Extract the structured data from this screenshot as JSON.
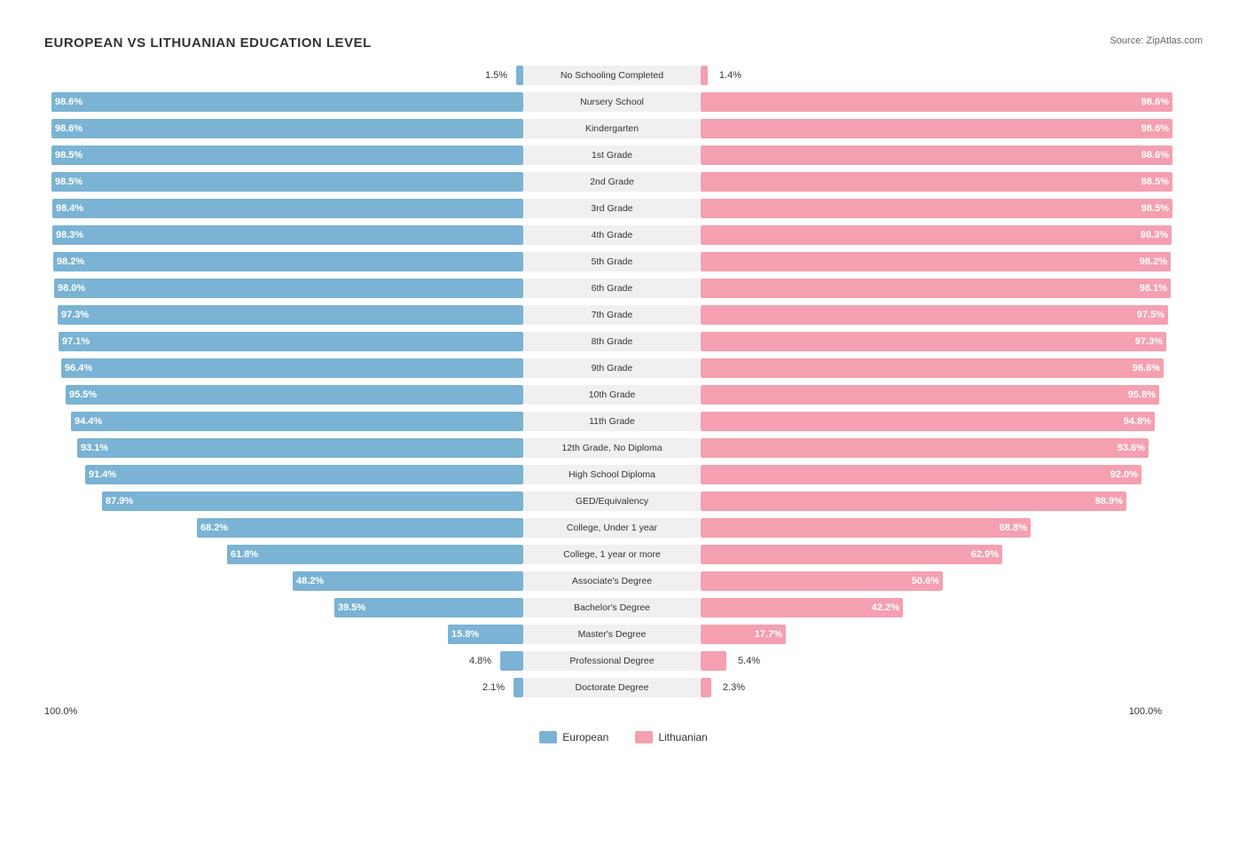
{
  "title": "EUROPEAN VS LITHUANIAN EDUCATION LEVEL",
  "source": "Source: ZipAtlas.com",
  "colors": {
    "blue": "#7ab3d4",
    "pink": "#f4a0b0",
    "label_bg": "#e8e8e8"
  },
  "legend": {
    "european": "European",
    "lithuanian": "Lithuanian"
  },
  "axis": {
    "left": "100.0%",
    "right": "100.0%"
  },
  "rows": [
    {
      "label": "No Schooling Completed",
      "left_val": "1.5%",
      "right_val": "1.4%",
      "left_pct": 1.5,
      "right_pct": 1.4
    },
    {
      "label": "Nursery School",
      "left_val": "98.6%",
      "right_val": "98.6%",
      "left_pct": 98.6,
      "right_pct": 98.6
    },
    {
      "label": "Kindergarten",
      "left_val": "98.6%",
      "right_val": "98.6%",
      "left_pct": 98.6,
      "right_pct": 98.6
    },
    {
      "label": "1st Grade",
      "left_val": "98.5%",
      "right_val": "98.6%",
      "left_pct": 98.5,
      "right_pct": 98.6
    },
    {
      "label": "2nd Grade",
      "left_val": "98.5%",
      "right_val": "98.5%",
      "left_pct": 98.5,
      "right_pct": 98.5
    },
    {
      "label": "3rd Grade",
      "left_val": "98.4%",
      "right_val": "98.5%",
      "left_pct": 98.4,
      "right_pct": 98.5
    },
    {
      "label": "4th Grade",
      "left_val": "98.3%",
      "right_val": "98.3%",
      "left_pct": 98.3,
      "right_pct": 98.3
    },
    {
      "label": "5th Grade",
      "left_val": "98.2%",
      "right_val": "98.2%",
      "left_pct": 98.2,
      "right_pct": 98.2
    },
    {
      "label": "6th Grade",
      "left_val": "98.0%",
      "right_val": "98.1%",
      "left_pct": 98.0,
      "right_pct": 98.1
    },
    {
      "label": "7th Grade",
      "left_val": "97.3%",
      "right_val": "97.5%",
      "left_pct": 97.3,
      "right_pct": 97.5
    },
    {
      "label": "8th Grade",
      "left_val": "97.1%",
      "right_val": "97.3%",
      "left_pct": 97.1,
      "right_pct": 97.3
    },
    {
      "label": "9th Grade",
      "left_val": "96.4%",
      "right_val": "96.6%",
      "left_pct": 96.4,
      "right_pct": 96.6
    },
    {
      "label": "10th Grade",
      "left_val": "95.5%",
      "right_val": "95.8%",
      "left_pct": 95.5,
      "right_pct": 95.8
    },
    {
      "label": "11th Grade",
      "left_val": "94.4%",
      "right_val": "94.8%",
      "left_pct": 94.4,
      "right_pct": 94.8
    },
    {
      "label": "12th Grade, No Diploma",
      "left_val": "93.1%",
      "right_val": "93.6%",
      "left_pct": 93.1,
      "right_pct": 93.6
    },
    {
      "label": "High School Diploma",
      "left_val": "91.4%",
      "right_val": "92.0%",
      "left_pct": 91.4,
      "right_pct": 92.0
    },
    {
      "label": "GED/Equivalency",
      "left_val": "87.9%",
      "right_val": "88.9%",
      "left_pct": 87.9,
      "right_pct": 88.9
    },
    {
      "label": "College, Under 1 year",
      "left_val": "68.2%",
      "right_val": "68.8%",
      "left_pct": 68.2,
      "right_pct": 68.8
    },
    {
      "label": "College, 1 year or more",
      "left_val": "61.8%",
      "right_val": "62.9%",
      "left_pct": 61.8,
      "right_pct": 62.9
    },
    {
      "label": "Associate's Degree",
      "left_val": "48.2%",
      "right_val": "50.6%",
      "left_pct": 48.2,
      "right_pct": 50.6
    },
    {
      "label": "Bachelor's Degree",
      "left_val": "39.5%",
      "right_val": "42.2%",
      "left_pct": 39.5,
      "right_pct": 42.2
    },
    {
      "label": "Master's Degree",
      "left_val": "15.8%",
      "right_val": "17.7%",
      "left_pct": 15.8,
      "right_pct": 17.7
    },
    {
      "label": "Professional Degree",
      "left_val": "4.8%",
      "right_val": "5.4%",
      "left_pct": 4.8,
      "right_pct": 5.4
    },
    {
      "label": "Doctorate Degree",
      "left_val": "2.1%",
      "right_val": "2.3%",
      "left_pct": 2.1,
      "right_pct": 2.3
    }
  ]
}
